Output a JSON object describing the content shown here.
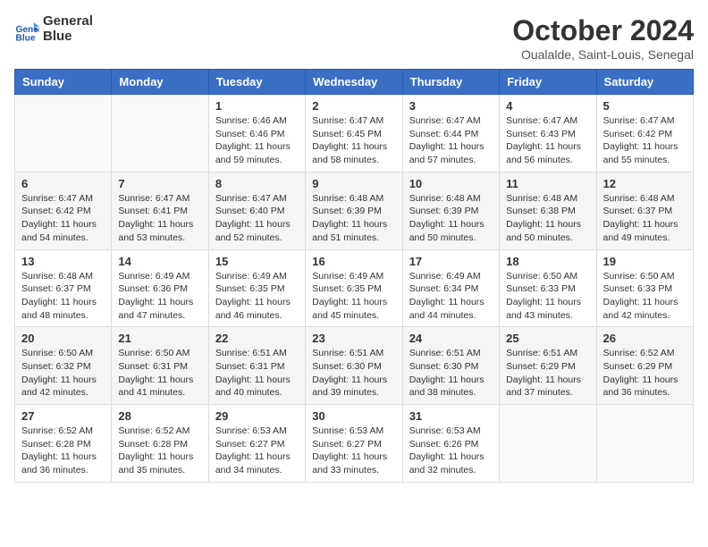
{
  "header": {
    "logo_line1": "General",
    "logo_line2": "Blue",
    "month_title": "October 2024",
    "location": "Oualalde, Saint-Louis, Senegal"
  },
  "days_of_week": [
    "Sunday",
    "Monday",
    "Tuesday",
    "Wednesday",
    "Thursday",
    "Friday",
    "Saturday"
  ],
  "weeks": [
    [
      {
        "day": "",
        "sunrise": "",
        "sunset": "",
        "daylight": ""
      },
      {
        "day": "",
        "sunrise": "",
        "sunset": "",
        "daylight": ""
      },
      {
        "day": "1",
        "sunrise": "Sunrise: 6:46 AM",
        "sunset": "Sunset: 6:46 PM",
        "daylight": "Daylight: 11 hours and 59 minutes."
      },
      {
        "day": "2",
        "sunrise": "Sunrise: 6:47 AM",
        "sunset": "Sunset: 6:45 PM",
        "daylight": "Daylight: 11 hours and 58 minutes."
      },
      {
        "day": "3",
        "sunrise": "Sunrise: 6:47 AM",
        "sunset": "Sunset: 6:44 PM",
        "daylight": "Daylight: 11 hours and 57 minutes."
      },
      {
        "day": "4",
        "sunrise": "Sunrise: 6:47 AM",
        "sunset": "Sunset: 6:43 PM",
        "daylight": "Daylight: 11 hours and 56 minutes."
      },
      {
        "day": "5",
        "sunrise": "Sunrise: 6:47 AM",
        "sunset": "Sunset: 6:42 PM",
        "daylight": "Daylight: 11 hours and 55 minutes."
      }
    ],
    [
      {
        "day": "6",
        "sunrise": "Sunrise: 6:47 AM",
        "sunset": "Sunset: 6:42 PM",
        "daylight": "Daylight: 11 hours and 54 minutes."
      },
      {
        "day": "7",
        "sunrise": "Sunrise: 6:47 AM",
        "sunset": "Sunset: 6:41 PM",
        "daylight": "Daylight: 11 hours and 53 minutes."
      },
      {
        "day": "8",
        "sunrise": "Sunrise: 6:47 AM",
        "sunset": "Sunset: 6:40 PM",
        "daylight": "Daylight: 11 hours and 52 minutes."
      },
      {
        "day": "9",
        "sunrise": "Sunrise: 6:48 AM",
        "sunset": "Sunset: 6:39 PM",
        "daylight": "Daylight: 11 hours and 51 minutes."
      },
      {
        "day": "10",
        "sunrise": "Sunrise: 6:48 AM",
        "sunset": "Sunset: 6:39 PM",
        "daylight": "Daylight: 11 hours and 50 minutes."
      },
      {
        "day": "11",
        "sunrise": "Sunrise: 6:48 AM",
        "sunset": "Sunset: 6:38 PM",
        "daylight": "Daylight: 11 hours and 50 minutes."
      },
      {
        "day": "12",
        "sunrise": "Sunrise: 6:48 AM",
        "sunset": "Sunset: 6:37 PM",
        "daylight": "Daylight: 11 hours and 49 minutes."
      }
    ],
    [
      {
        "day": "13",
        "sunrise": "Sunrise: 6:48 AM",
        "sunset": "Sunset: 6:37 PM",
        "daylight": "Daylight: 11 hours and 48 minutes."
      },
      {
        "day": "14",
        "sunrise": "Sunrise: 6:49 AM",
        "sunset": "Sunset: 6:36 PM",
        "daylight": "Daylight: 11 hours and 47 minutes."
      },
      {
        "day": "15",
        "sunrise": "Sunrise: 6:49 AM",
        "sunset": "Sunset: 6:35 PM",
        "daylight": "Daylight: 11 hours and 46 minutes."
      },
      {
        "day": "16",
        "sunrise": "Sunrise: 6:49 AM",
        "sunset": "Sunset: 6:35 PM",
        "daylight": "Daylight: 11 hours and 45 minutes."
      },
      {
        "day": "17",
        "sunrise": "Sunrise: 6:49 AM",
        "sunset": "Sunset: 6:34 PM",
        "daylight": "Daylight: 11 hours and 44 minutes."
      },
      {
        "day": "18",
        "sunrise": "Sunrise: 6:50 AM",
        "sunset": "Sunset: 6:33 PM",
        "daylight": "Daylight: 11 hours and 43 minutes."
      },
      {
        "day": "19",
        "sunrise": "Sunrise: 6:50 AM",
        "sunset": "Sunset: 6:33 PM",
        "daylight": "Daylight: 11 hours and 42 minutes."
      }
    ],
    [
      {
        "day": "20",
        "sunrise": "Sunrise: 6:50 AM",
        "sunset": "Sunset: 6:32 PM",
        "daylight": "Daylight: 11 hours and 42 minutes."
      },
      {
        "day": "21",
        "sunrise": "Sunrise: 6:50 AM",
        "sunset": "Sunset: 6:31 PM",
        "daylight": "Daylight: 11 hours and 41 minutes."
      },
      {
        "day": "22",
        "sunrise": "Sunrise: 6:51 AM",
        "sunset": "Sunset: 6:31 PM",
        "daylight": "Daylight: 11 hours and 40 minutes."
      },
      {
        "day": "23",
        "sunrise": "Sunrise: 6:51 AM",
        "sunset": "Sunset: 6:30 PM",
        "daylight": "Daylight: 11 hours and 39 minutes."
      },
      {
        "day": "24",
        "sunrise": "Sunrise: 6:51 AM",
        "sunset": "Sunset: 6:30 PM",
        "daylight": "Daylight: 11 hours and 38 minutes."
      },
      {
        "day": "25",
        "sunrise": "Sunrise: 6:51 AM",
        "sunset": "Sunset: 6:29 PM",
        "daylight": "Daylight: 11 hours and 37 minutes."
      },
      {
        "day": "26",
        "sunrise": "Sunrise: 6:52 AM",
        "sunset": "Sunset: 6:29 PM",
        "daylight": "Daylight: 11 hours and 36 minutes."
      }
    ],
    [
      {
        "day": "27",
        "sunrise": "Sunrise: 6:52 AM",
        "sunset": "Sunset: 6:28 PM",
        "daylight": "Daylight: 11 hours and 36 minutes."
      },
      {
        "day": "28",
        "sunrise": "Sunrise: 6:52 AM",
        "sunset": "Sunset: 6:28 PM",
        "daylight": "Daylight: 11 hours and 35 minutes."
      },
      {
        "day": "29",
        "sunrise": "Sunrise: 6:53 AM",
        "sunset": "Sunset: 6:27 PM",
        "daylight": "Daylight: 11 hours and 34 minutes."
      },
      {
        "day": "30",
        "sunrise": "Sunrise: 6:53 AM",
        "sunset": "Sunset: 6:27 PM",
        "daylight": "Daylight: 11 hours and 33 minutes."
      },
      {
        "day": "31",
        "sunrise": "Sunrise: 6:53 AM",
        "sunset": "Sunset: 6:26 PM",
        "daylight": "Daylight: 11 hours and 32 minutes."
      },
      {
        "day": "",
        "sunrise": "",
        "sunset": "",
        "daylight": ""
      },
      {
        "day": "",
        "sunrise": "",
        "sunset": "",
        "daylight": ""
      }
    ]
  ]
}
